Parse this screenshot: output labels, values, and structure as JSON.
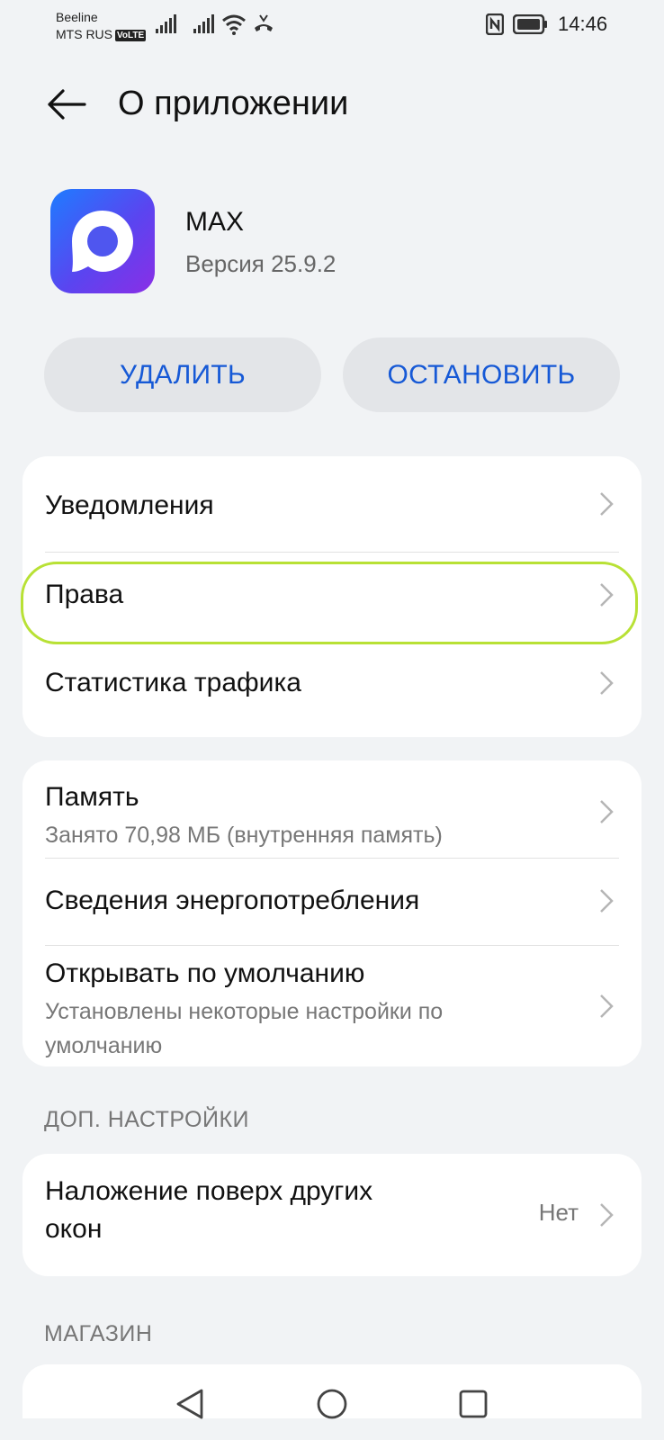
{
  "status_bar": {
    "carrier_1": "Beeline",
    "carrier_2": "MTS RUS",
    "volte": "VoLTE",
    "time": "14:46"
  },
  "header": {
    "title": "О приложении",
    "back_icon": "arrow-left-icon"
  },
  "app": {
    "name": "MAX",
    "version": "Версия 25.9.2",
    "brand_colors": [
      "#1e7cff",
      "#5a45f0",
      "#8a2ee6"
    ]
  },
  "actions": {
    "delete_label": "УДАЛИТЬ",
    "stop_label": "ОСТАНОВИТЬ",
    "accent_color": "#1659d6"
  },
  "group1": {
    "items": [
      {
        "label": "Уведомления"
      },
      {
        "label": "Права"
      },
      {
        "label": "Статистика трафика"
      }
    ]
  },
  "group2": {
    "items": [
      {
        "label": "Память",
        "sub": "Занято 70,98 МБ (внутренняя память)"
      },
      {
        "label": "Сведения энергопотребления"
      },
      {
        "label": "Открывать по умолчанию",
        "sub_1": "Установлены некоторые настройки по",
        "sub_2": "умолчанию"
      }
    ]
  },
  "extra": {
    "section_title": "ДОП. НАСТРОЙКИ",
    "items": [
      {
        "label_1": "Наложение поверх других",
        "label_2": "окон",
        "value": "Нет"
      }
    ]
  },
  "store": {
    "section_title": "МАГАЗИН"
  },
  "highlight_color": "#b8e135"
}
